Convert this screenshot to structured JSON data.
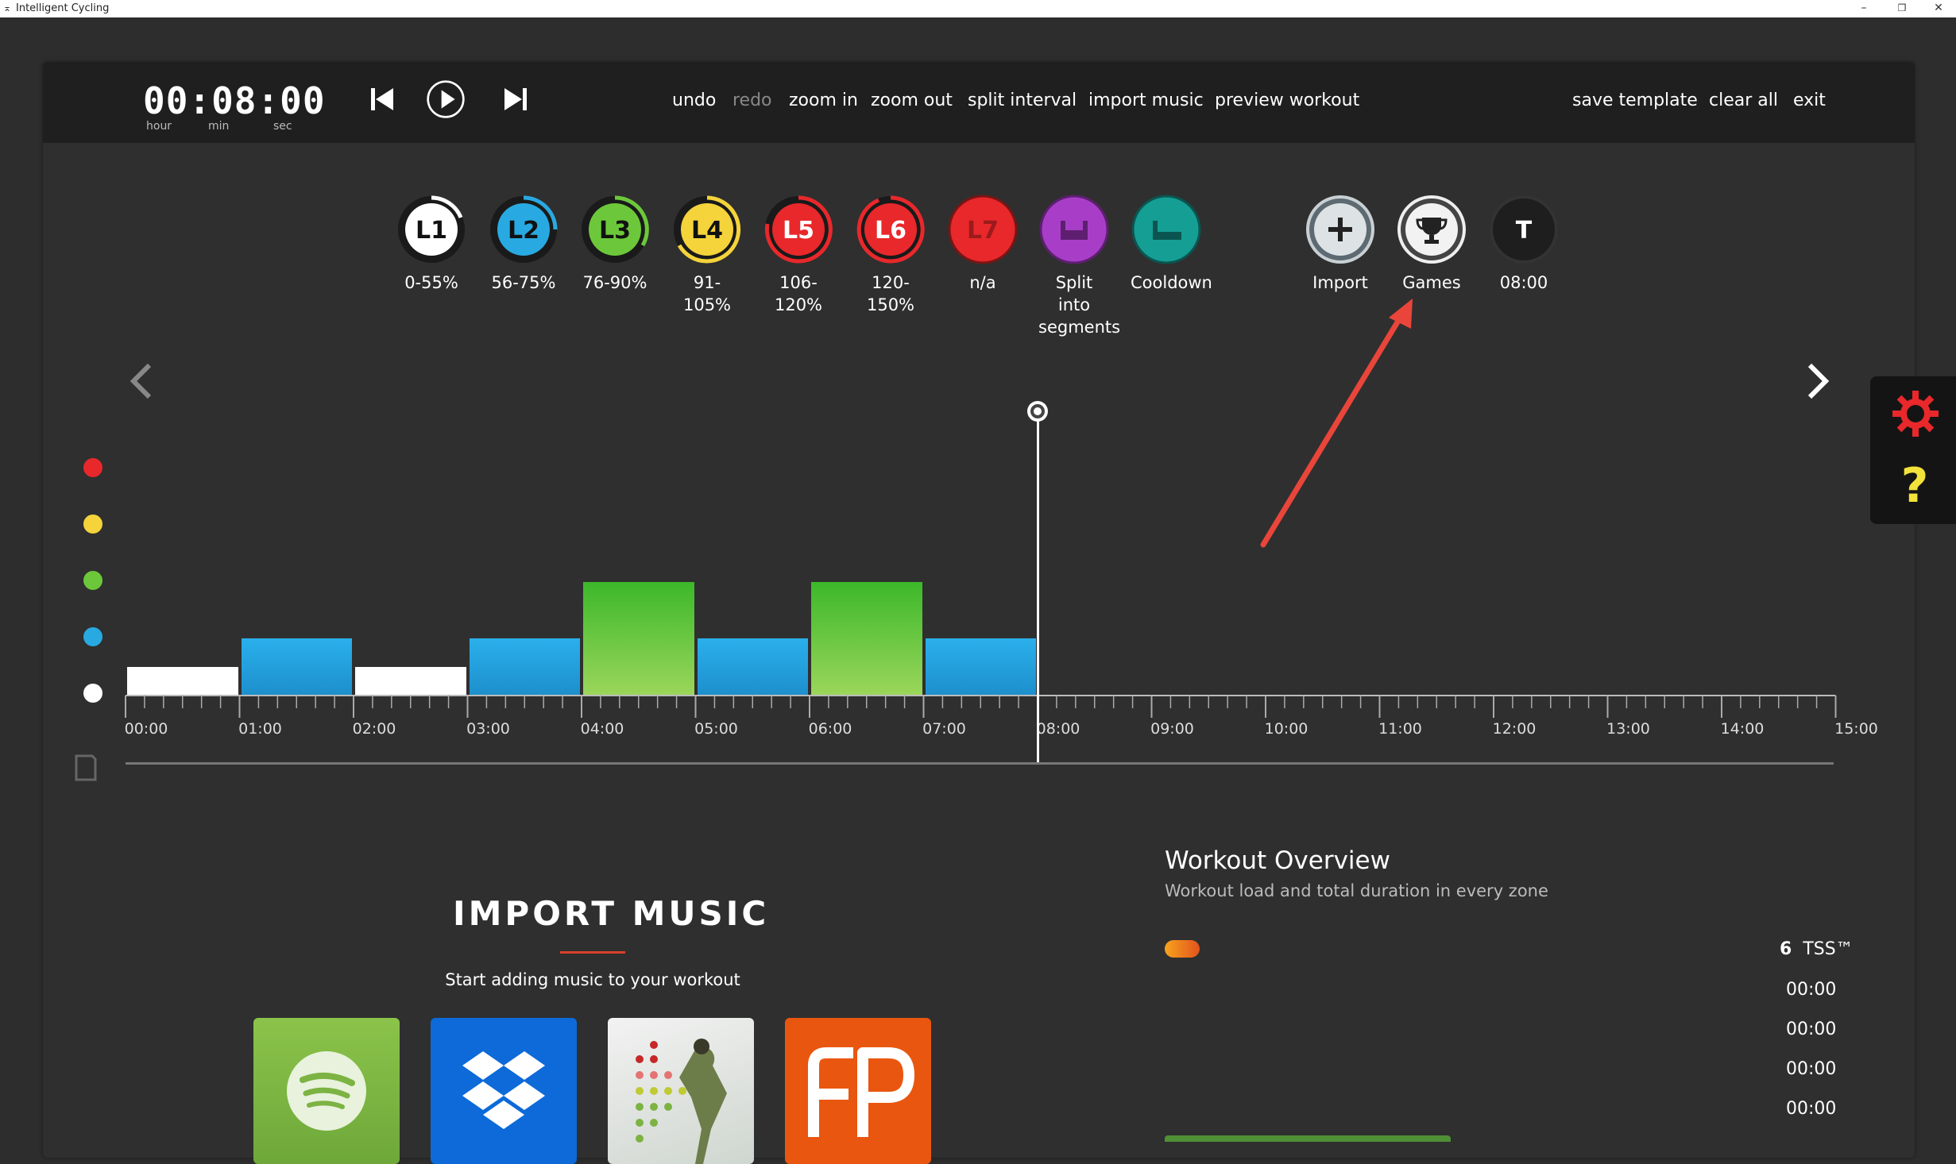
{
  "window": {
    "title": "Intelligent Cycling",
    "minimize": "–",
    "restore": "❐",
    "close": "✕"
  },
  "timer": {
    "display": "00:08:00",
    "units": [
      "hour",
      "min",
      "sec"
    ]
  },
  "menu": [
    {
      "label": "undo",
      "enabled": true
    },
    {
      "label": "redo",
      "enabled": false
    },
    {
      "label": "zoom in",
      "enabled": true
    },
    {
      "label": "zoom out",
      "enabled": true
    },
    {
      "label": "split interval",
      "enabled": true
    },
    {
      "label": "import music",
      "enabled": true
    },
    {
      "label": "preview workout",
      "enabled": true
    },
    {
      "label": "save template",
      "enabled": true
    },
    {
      "label": "clear all",
      "enabled": true
    },
    {
      "label": "exit",
      "enabled": true
    }
  ],
  "zones": [
    {
      "code": "L1",
      "label": "0-55%",
      "color": "#ffffff",
      "text": "#111111"
    },
    {
      "code": "L2",
      "label": "56-75%",
      "color": "#29a9e1",
      "text": "#111111"
    },
    {
      "code": "L3",
      "label": "76-90%",
      "color": "#6cc83a",
      "text": "#111111"
    },
    {
      "code": "L4",
      "label": "91-105%",
      "color": "#f5d33b",
      "text": "#111111"
    },
    {
      "code": "L5",
      "label": "106-120%",
      "color": "#e8282b",
      "text": "#ffffff"
    },
    {
      "code": "L6",
      "label": "120-150%",
      "color": "#e8282b",
      "text": "#ffffff"
    },
    {
      "code": "L7",
      "label": "n/a",
      "color": "#e8282b",
      "text": "#ffffff"
    },
    {
      "code": "split",
      "label": "Split into segments",
      "color": "#a83ec7",
      "text": "#ffffff"
    },
    {
      "code": "cooldown",
      "label": "Cooldown",
      "color": "#159e94",
      "text": "#ffffff"
    }
  ],
  "tools": [
    {
      "code": "import",
      "label": "Import",
      "icon": "plus-icon"
    },
    {
      "code": "games",
      "label": "Games",
      "icon": "trophy-icon"
    },
    {
      "code": "T",
      "label": "08:00",
      "icon": "T"
    }
  ],
  "legend_colors": [
    "#e8282b",
    "#f5d33b",
    "#6cc83a",
    "#29a9e1",
    "#ffffff"
  ],
  "timeline": {
    "ticks": [
      "00:00",
      "01:00",
      "02:00",
      "03:00",
      "04:00",
      "05:00",
      "06:00",
      "07:00",
      "08:00",
      "09:00",
      "10:00",
      "11:00",
      "12:00",
      "13:00",
      "14:00",
      "15:00"
    ],
    "playhead_minutes": 8,
    "intervals": [
      {
        "start": 0,
        "end": 1,
        "zone": "L1"
      },
      {
        "start": 1,
        "end": 2,
        "zone": "L2"
      },
      {
        "start": 2,
        "end": 3,
        "zone": "L1"
      },
      {
        "start": 3,
        "end": 4,
        "zone": "L2"
      },
      {
        "start": 4,
        "end": 5,
        "zone": "L3"
      },
      {
        "start": 5,
        "end": 6,
        "zone": "L2"
      },
      {
        "start": 6,
        "end": 7,
        "zone": "L3"
      },
      {
        "start": 7,
        "end": 8,
        "zone": "L2"
      }
    ]
  },
  "import_music": {
    "title": "IMPORT MUSIC",
    "subtitle": "Start adding music to your workout",
    "sources": [
      "spotify-icon",
      "dropbox-icon",
      "music-library-icon",
      "fitradio-icon"
    ]
  },
  "workout_overview": {
    "title": "Workout Overview",
    "subtitle": "Workout load and total duration in every zone",
    "tss_value": "6",
    "tss_label": "TSS™",
    "zone_times": [
      "00:00",
      "00:00",
      "00:00",
      "00:00"
    ]
  }
}
